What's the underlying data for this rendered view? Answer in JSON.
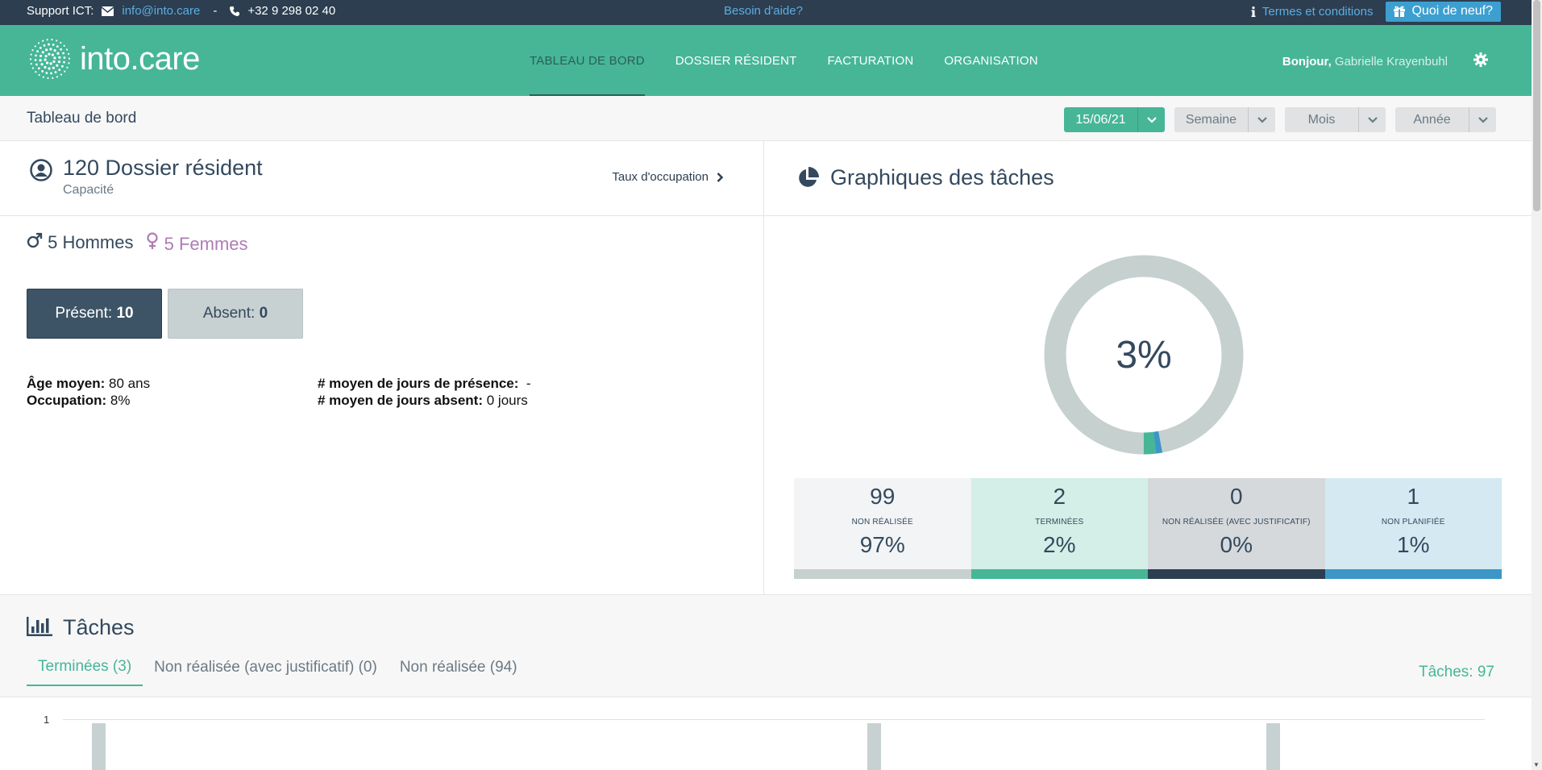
{
  "topbar": {
    "support_label": "Support ICT:",
    "email": "info@into.care",
    "separator": "-",
    "phone": "+32 9 298 02 40",
    "help": "Besoin d'aide?",
    "terms": "Termes et conditions",
    "news": "Quoi de neuf?"
  },
  "header": {
    "logo_text": "into.care",
    "nav": [
      {
        "label": "TABLEAU DE BORD",
        "active": true
      },
      {
        "label": "DOSSIER RÉSIDENT",
        "active": false
      },
      {
        "label": "FACTURATION",
        "active": false
      },
      {
        "label": "ORGANISATION",
        "active": false
      }
    ],
    "greeting": "Bonjour,",
    "user": "Gabrielle Krayenbuhl"
  },
  "subheader": {
    "title": "Tableau de bord",
    "date": "15/06/21",
    "week": "Semaine",
    "month": "Mois",
    "year": "Année"
  },
  "residents": {
    "count_title": "120 Dossier résident",
    "capacity_label": "Capacité",
    "occupancy_link": "Taux d'occupation",
    "men": "5 Hommes",
    "women": "5 Femmes",
    "present_label": "Présent:",
    "present_value": "10",
    "absent_label": "Absent:",
    "absent_value": "0",
    "age_label": "Âge moyen:",
    "age_value": "80 ans",
    "occupation_label": "Occupation:",
    "occupation_value": "8%",
    "presence_days_label": "# moyen de jours de présence:",
    "presence_days_value": "-",
    "absent_days_label": "# moyen de jours absent:",
    "absent_days_value": "0 jours"
  },
  "task_chart": {
    "title": "Graphiques des tâches",
    "center_percent": "3%",
    "cards": [
      {
        "value": "99",
        "label": "NON RÉALISÉE",
        "percent": "97%",
        "fraction": 0.97,
        "bg": "#f2f4f5",
        "bar": "#c5d0cf"
      },
      {
        "value": "2",
        "label": "TERMINÉES",
        "percent": "2%",
        "fraction": 0.02,
        "bg": "#d3efe7",
        "bar": "#46b697"
      },
      {
        "value": "0",
        "label": "NON RÉALISÉE (AVEC JUSTIFICATIF)",
        "percent": "0%",
        "fraction": 0.0,
        "bg": "#d6d9dc",
        "bar": "#2c3e50"
      },
      {
        "value": "1",
        "label": "NON PLANIFIÉE",
        "percent": "1%",
        "fraction": 0.01,
        "bg": "#d4e9f2",
        "bar": "#3c97c7"
      }
    ]
  },
  "tasks": {
    "title": "Tâches",
    "tabs": [
      {
        "label": "Terminées (3)",
        "active": true
      },
      {
        "label": "Non réalisée (avec justificatif) (0)",
        "active": false
      },
      {
        "label": "Non réalisée (94)",
        "active": false
      }
    ],
    "total": "Tâches: 97",
    "y_tick": "1"
  },
  "colors": {
    "topbar": "#2c3e50",
    "brand_green": "#46b697",
    "link_blue": "#5dade2",
    "female": "#b07bb5"
  },
  "icons": [
    "envelope-icon",
    "phone-icon",
    "info-icon",
    "gift-icon",
    "gear-icon",
    "user-circle-icon",
    "chevron-right-icon",
    "pie-chart-icon",
    "bar-chart-icon",
    "male-icon",
    "female-icon",
    "chevron-down-icon"
  ]
}
